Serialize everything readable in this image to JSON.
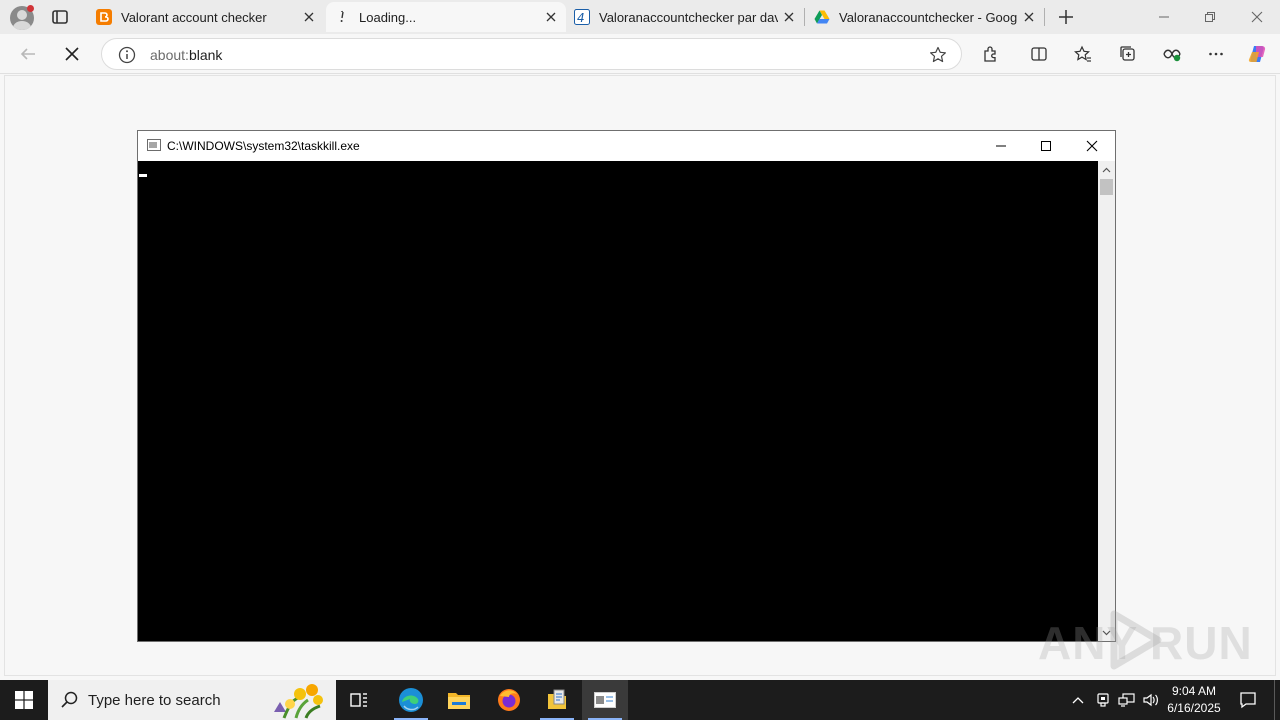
{
  "browser": {
    "tabs": [
      {
        "title": "Valorant account checker",
        "favicon": "blogger-icon",
        "active": false
      },
      {
        "title": "Loading...",
        "favicon": "loading-icon",
        "active": true
      },
      {
        "title": "Valoranaccountchecker par david",
        "favicon": "4shared-icon",
        "active": false
      },
      {
        "title": "Valoranaccountchecker - Google",
        "favicon": "google-drive-icon",
        "active": false
      }
    ],
    "address": {
      "scheme": "about:",
      "path": "blank"
    }
  },
  "console": {
    "title": "C:\\WINDOWS\\system32\\taskkill.exe"
  },
  "watermark": {
    "text_left": "ANY",
    "text_right": "RUN"
  },
  "taskbar": {
    "search_placeholder": "Type here to search",
    "time": "9:04 AM",
    "date": "6/16/2025"
  },
  "colors": {
    "console_bg": "#000000",
    "taskbar_bg": "#1c1c1c",
    "tabstrip_bg": "#ebebeb"
  }
}
